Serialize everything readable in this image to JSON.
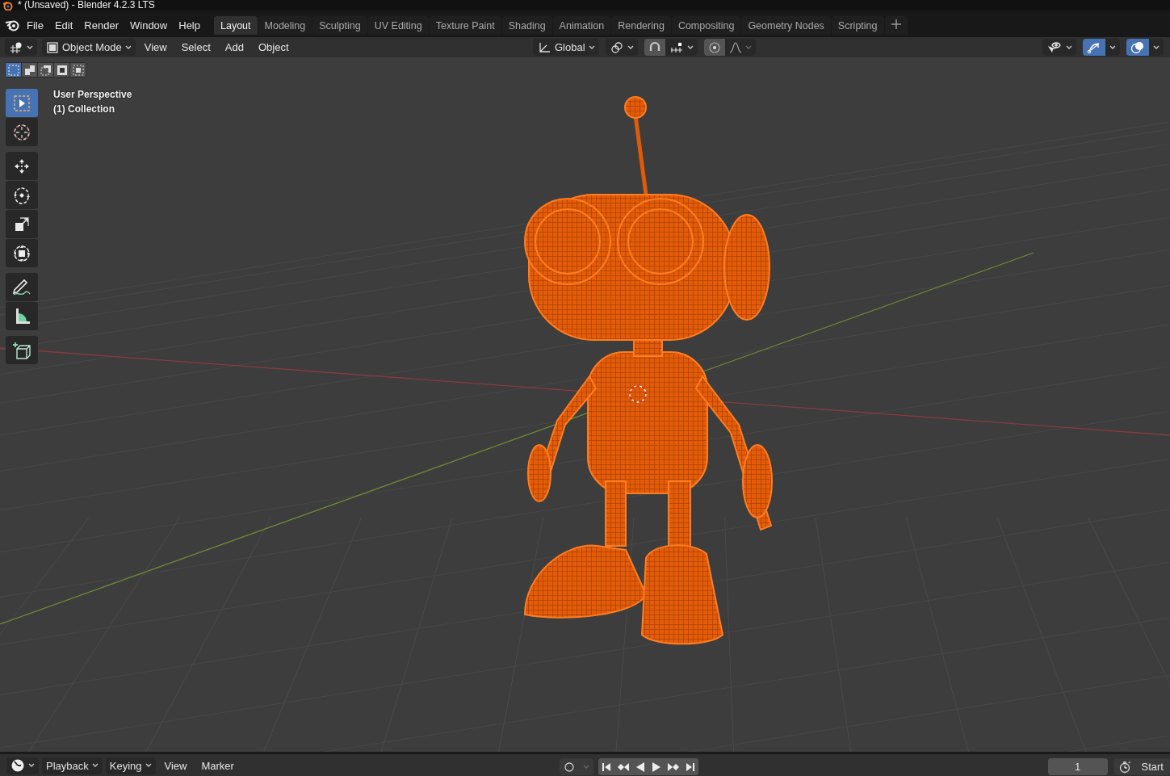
{
  "window": {
    "title": "* (Unsaved) - Blender 4.2.3 LTS"
  },
  "menu": [
    "File",
    "Edit",
    "Render",
    "Window",
    "Help"
  ],
  "workspaces": [
    {
      "label": "Layout",
      "selected": true
    },
    {
      "label": "Modeling",
      "selected": false
    },
    {
      "label": "Sculpting",
      "selected": false
    },
    {
      "label": "UV Editing",
      "selected": false
    },
    {
      "label": "Texture Paint",
      "selected": false
    },
    {
      "label": "Shading",
      "selected": false
    },
    {
      "label": "Animation",
      "selected": false
    },
    {
      "label": "Rendering",
      "selected": false
    },
    {
      "label": "Compositing",
      "selected": false
    },
    {
      "label": "Geometry Nodes",
      "selected": false
    },
    {
      "label": "Scripting",
      "selected": false
    }
  ],
  "header": {
    "mode": "Object Mode",
    "menus": [
      "View",
      "Select",
      "Add",
      "Object"
    ],
    "orientation": "Global",
    "gizmos_on": true,
    "overlays_on": true
  },
  "select_modes": [
    {
      "selected": true
    },
    {
      "selected": false
    },
    {
      "selected": false
    },
    {
      "selected": false
    },
    {
      "selected": false
    }
  ],
  "viewport": {
    "view_name": "User Perspective",
    "collection": "(1) Collection"
  },
  "tools": [
    {
      "kind": "select",
      "selected": true
    },
    {
      "kind": "cursor",
      "selected": false
    },
    {
      "kind": "move",
      "selected": false
    },
    {
      "kind": "rotate",
      "selected": false
    },
    {
      "kind": "scale",
      "selected": false
    },
    {
      "kind": "transform",
      "selected": false
    },
    {
      "kind": "annotate",
      "selected": false
    },
    {
      "kind": "measure",
      "selected": false
    },
    {
      "kind": "add-cube",
      "selected": false
    }
  ],
  "timeline": {
    "dropdowns": [
      "Playback",
      "Keying"
    ],
    "menus": [
      "View",
      "Marker"
    ],
    "frame": "1",
    "range_label": "Start"
  }
}
